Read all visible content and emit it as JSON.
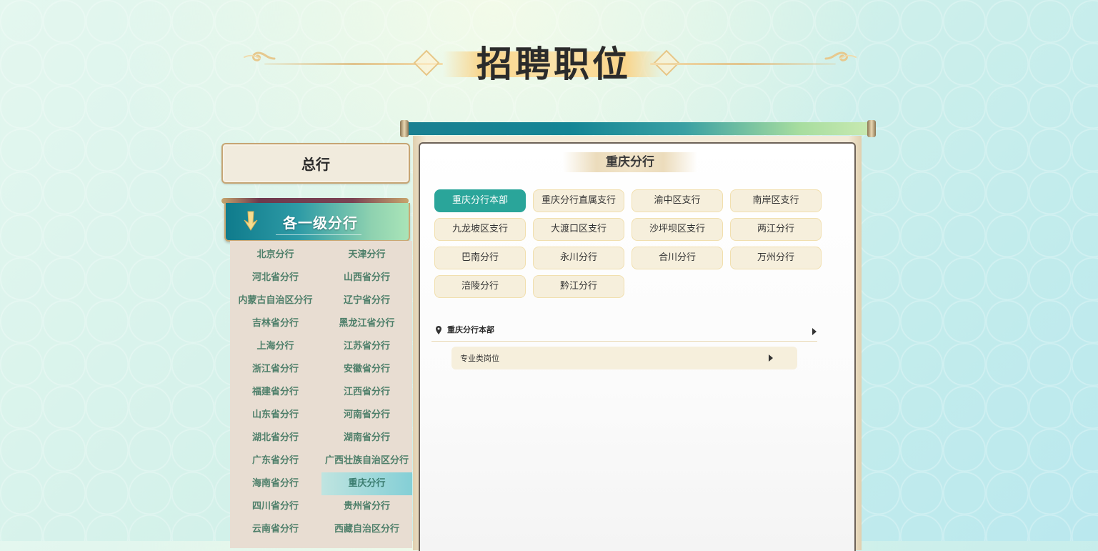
{
  "page_title": "招聘职位",
  "sidebar": {
    "hq_label": "总行",
    "branch_header": "各一级分行",
    "branches": [
      "北京分行",
      "天津分行",
      "河北省分行",
      "山西省分行",
      "内蒙古自治区分行",
      "辽宁省分行",
      "吉林省分行",
      "黑龙江省分行",
      "上海分行",
      "江苏省分行",
      "浙江省分行",
      "安徽省分行",
      "福建省分行",
      "江西省分行",
      "山东省分行",
      "河南省分行",
      "湖北省分行",
      "湖南省分行",
      "广东省分行",
      "广西壮族自治区分行",
      "海南省分行",
      "重庆分行",
      "四川省分行",
      "贵州省分行",
      "云南省分行",
      "西藏自治区分行"
    ],
    "active_branch": "重庆分行"
  },
  "panel": {
    "title": "重庆分行",
    "sub_branches": [
      "重庆分行本部",
      "重庆分行直属支行",
      "渝中区支行",
      "南岸区支行",
      "九龙坡区支行",
      "大渡口区支行",
      "沙坪坝区支行",
      "两江分行",
      "巴南分行",
      "永川分行",
      "合川分行",
      "万州分行",
      "涪陵分行",
      "黔江分行"
    ],
    "active_sub_branch": "重庆分行本部",
    "location_label": "重庆分行本部",
    "category_label": "专业类岗位"
  },
  "colors": {
    "accent": "#2aa59a",
    "branch_text": "#4e7f6a",
    "sub_button_bg": "#f6efdc"
  }
}
